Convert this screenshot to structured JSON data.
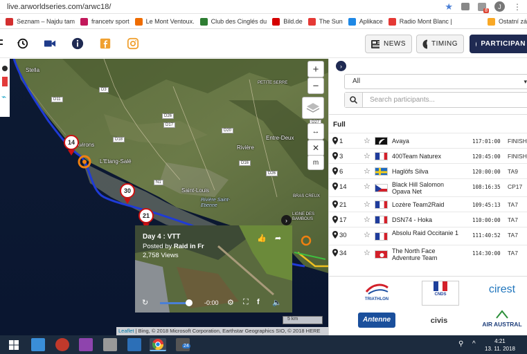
{
  "browser": {
    "url": "live.arworldseries.com/arwc18/",
    "notification_count": "8",
    "profile_initial": "J"
  },
  "bookmarks": [
    {
      "label": "Seznam – Najdu tam",
      "color": "#d32f2f"
    },
    {
      "label": "francetv sport",
      "color": "#c2185b"
    },
    {
      "label": "Le Mont Ventoux.",
      "color": "#ef6c00"
    },
    {
      "label": "Club des Cinglés du",
      "color": "#2e7d32"
    },
    {
      "label": "Bild.de",
      "color": "#d50000"
    },
    {
      "label": "The Sun",
      "color": "#e53935"
    },
    {
      "label": "Aplikace",
      "color": "#1e88e5"
    },
    {
      "label": "Radio Mont Blanc |",
      "color": "#e53935"
    },
    {
      "label": "Ostatní zá",
      "color": "#f9a825"
    }
  ],
  "toolbar": {
    "news_label": "NEWS",
    "timing_label": "TIMING",
    "participants_label": "PARTICIPAN"
  },
  "map": {
    "places": {
      "stella": "Stella",
      "avirons": "Les Avirons",
      "etang_sale": "L'Etang-Salé",
      "saint_louis": "Saint-Louis",
      "riviere": "Rivière",
      "entre_deux": "Entre-Deux",
      "petite_serre": "PETITE SERRE",
      "riviere_st_etienne": "Rivière Saint-Etienne",
      "ligne_bambous": "LIGNE DES BAMBOUS",
      "bras_creux": "BRAS CREUX"
    },
    "roads": [
      "D3",
      "D11",
      "D18",
      "D26",
      "D27",
      "D17",
      "D20",
      "D16",
      "N1",
      "D26"
    ],
    "markers": [
      "14",
      "30",
      "21"
    ],
    "zoom_in": "+",
    "zoom_out": "−",
    "measure_label": "m",
    "scale_label": "5 km",
    "attribution_link": "Leaflet",
    "attribution_text": " | Bing, © 2018 Microsoft Corporation, Earthstar Geographics SIO, © 2018 HERE"
  },
  "video": {
    "title": "Day 4 : VTT",
    "posted_prefix": "Posted by ",
    "author": "Raid in Fr",
    "views": "2,758 Views",
    "time": "-0:00",
    "progress": 0.5
  },
  "panel": {
    "filter_value": "All",
    "search_placeholder": "Search participants...",
    "section_title": "Full",
    "participants": [
      {
        "bib": "1",
        "team": "Avaya",
        "time": "117:01:00",
        "status": "FINISH",
        "flag": "nz"
      },
      {
        "bib": "3",
        "team": "400Team Naturex",
        "time": "120:45:00",
        "status": "FINISH",
        "flag": "fr"
      },
      {
        "bib": "6",
        "team": "Haglöfs Silva",
        "time": "120:00:00",
        "status": "TA9",
        "flag": "se"
      },
      {
        "bib": "14",
        "team": "Black Hill Salomon Opava Net",
        "time": "108:16:35",
        "status": "CP17",
        "flag": "cz"
      },
      {
        "bib": "21",
        "team": "Lozère Team2Raid",
        "time": "109:45:13",
        "status": "TA7",
        "flag": "fr"
      },
      {
        "bib": "17",
        "team": "DSN74 - Hoka",
        "time": "110:00:00",
        "status": "TA7",
        "flag": "fr"
      },
      {
        "bib": "30",
        "team": "Absolu Raid Occitanie 1",
        "time": "111:40:52",
        "status": "TA7",
        "flag": "fr"
      },
      {
        "bib": "34",
        "team": "The North Face Adventure Team",
        "time": "114:30:00",
        "status": "TA7",
        "flag": "hk"
      }
    ],
    "sponsors": {
      "triathlon": "TRIATHLON",
      "cnds": "CNDS",
      "cirest": "cirest",
      "antenne": "Antenne",
      "civis": "civis",
      "air_austral": "AIR AUSTRAL"
    }
  },
  "taskbar": {
    "mail_badge": "24",
    "time": "4:21",
    "date": "13. 11. 2018"
  }
}
